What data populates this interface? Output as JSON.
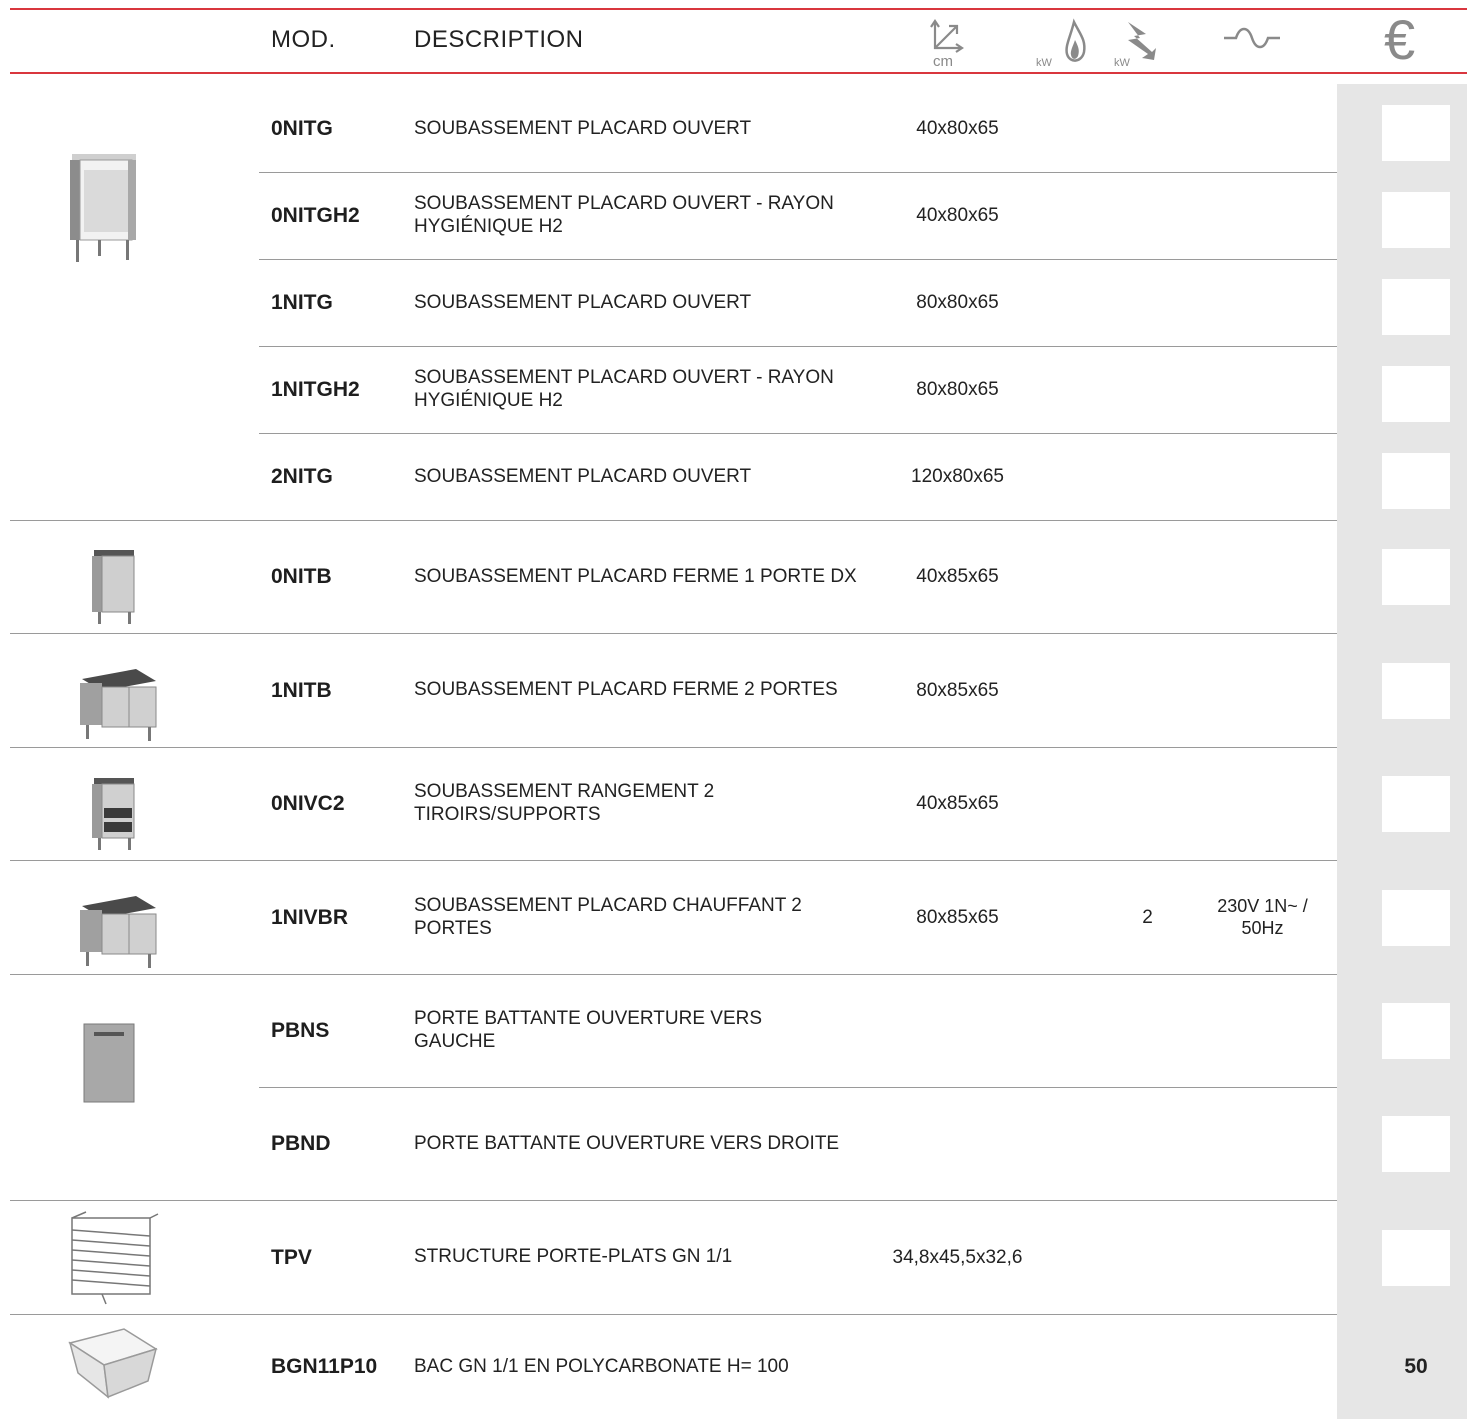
{
  "header": {
    "mod": "MOD.",
    "description": "DESCRIPTION",
    "dim_icon": "dimensions-cm-icon",
    "dim_unit": "cm",
    "gas_icon": "gas-flame-kw-icon",
    "gas_unit": "kW",
    "elec_icon": "electric-kw-icon",
    "elec_unit": "kW",
    "voltage_icon": "voltage-icon",
    "price_icon": "euro-icon",
    "price_symbol": "€"
  },
  "colors": {
    "accent": "#d9363e",
    "price_column": "#e6e6e6"
  },
  "rows": [
    {
      "mod": "0NITG",
      "desc": "SOUBASSEMENT PLACARD OUVERT",
      "dim": "40x80x65",
      "kw": "",
      "volt": "",
      "price": ""
    },
    {
      "mod": "0NITGH2",
      "desc": "SOUBASSEMENT PLACARD OUVERT - RAYON HYGIÉNIQUE H2",
      "dim": "40x80x65",
      "kw": "",
      "volt": "",
      "price": ""
    },
    {
      "mod": "1NITG",
      "desc": "SOUBASSEMENT PLACARD OUVERT",
      "dim": "80x80x65",
      "kw": "",
      "volt": "",
      "price": ""
    },
    {
      "mod": "1NITGH2",
      "desc": "SOUBASSEMENT PLACARD OUVERT - RAYON HYGIÉNIQUE H2",
      "dim": "80x80x65",
      "kw": "",
      "volt": "",
      "price": ""
    },
    {
      "mod": "2NITG",
      "desc": "SOUBASSEMENT PLACARD OUVERT",
      "dim": "120x80x65",
      "kw": "",
      "volt": "",
      "price": ""
    },
    {
      "mod": "0NITB",
      "desc": "SOUBASSEMENT PLACARD FERME 1 PORTE DX",
      "dim": "40x85x65",
      "kw": "",
      "volt": "",
      "price": ""
    },
    {
      "mod": "1NITB",
      "desc": "SOUBASSEMENT PLACARD FERME 2 PORTES",
      "dim": "80x85x65",
      "kw": "",
      "volt": "",
      "price": ""
    },
    {
      "mod": "0NIVC2",
      "desc": "SOUBASSEMENT RANGEMENT 2 TIROIRS/SUPPORTS",
      "dim": "40x85x65",
      "kw": "",
      "volt": "",
      "price": ""
    },
    {
      "mod": "1NIVBR",
      "desc": "SOUBASSEMENT PLACARD CHAUFFANT 2 PORTES",
      "dim": "80x85x65",
      "kw": "2",
      "volt": "230V 1N~ / 50Hz",
      "price": ""
    },
    {
      "mod": "PBNS",
      "desc": "PORTE BATTANTE OUVERTURE VERS GAUCHE",
      "dim": "",
      "kw": "",
      "volt": "",
      "price": ""
    },
    {
      "mod": "PBND",
      "desc": "PORTE BATTANTE OUVERTURE VERS DROITE",
      "dim": "",
      "kw": "",
      "volt": "",
      "price": ""
    },
    {
      "mod": "TPV",
      "desc": "STRUCTURE PORTE-PLATS GN 1/1",
      "dim": "34,8x45,5x32,6",
      "kw": "",
      "volt": "",
      "price": ""
    },
    {
      "mod": "BGN11P10",
      "desc": "BAC GN 1/1 EN POLYCARBONATE H= 100",
      "dim": "",
      "kw": "",
      "volt": "",
      "price": "50"
    }
  ],
  "images": [
    {
      "name": "open-cabinet-image"
    },
    {
      "name": "closed-cabinet-1-door-image"
    },
    {
      "name": "closed-cabinet-2-doors-image"
    },
    {
      "name": "drawer-cabinet-image"
    },
    {
      "name": "heated-cabinet-image"
    },
    {
      "name": "swing-door-image"
    },
    {
      "name": "tray-rack-image"
    },
    {
      "name": "polycarbonate-container-image"
    }
  ]
}
